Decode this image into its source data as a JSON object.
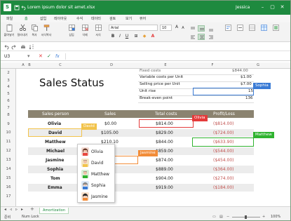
{
  "titlebar": {
    "title": "Lorem ipsum dolor sit amet.xlsx",
    "user": "Jessica",
    "logo": "S"
  },
  "ribbon_tabs": [
    "파일",
    "홈",
    "삽입",
    "레이아웃",
    "수식",
    "데이터",
    "검토",
    "보기",
    "뷰어"
  ],
  "ribbon": {
    "paste_label": "붙여넣기",
    "cut_label": "잘라내기",
    "copy_label": "복사",
    "format_painter_label": "서식복사",
    "insert_label": "삽입",
    "delete_label": "삭제",
    "format_label": "서식",
    "font_name": "Arial",
    "font_size": "10"
  },
  "formula_bar": {
    "name_box": "U3",
    "fx": "fx"
  },
  "columns": [
    "A",
    "B",
    "C",
    "D",
    "E",
    "F",
    "G"
  ],
  "rows": [
    "2",
    "3",
    "4",
    "5",
    "6",
    "7",
    "8",
    "9",
    "10",
    "11",
    "12",
    "13",
    "14",
    "15",
    "16",
    "17"
  ],
  "summary": {
    "fixed_label": "Fixed costs",
    "fixed_value": "$844.00",
    "variable_label": "Variable costs per Unit",
    "variable_value": "$1.00",
    "selling_label": "Selling price per Unit",
    "selling_value": "$7.00",
    "unit_rise_label": "Unit rise",
    "unit_rise_value": "15",
    "breakeven_label": "Break-even point",
    "breakeven_value": "136"
  },
  "sheet_title": "Sales Status",
  "table": {
    "headers": [
      "Sales person",
      "Sales",
      "Total costs",
      "Profit/Loss"
    ],
    "rows": [
      {
        "name": "Olivia",
        "sales": "$0.00",
        "costs": "$814.00",
        "profit": "($814.00)"
      },
      {
        "name": "David",
        "sales": "$105.00",
        "costs": "$829.00",
        "profit": "($724.00)"
      },
      {
        "name": "Matthew",
        "sales": "$210.10",
        "costs": "$844.00",
        "profit": "($633.90)"
      },
      {
        "name": "Michael",
        "sales": "",
        "costs": "$859.00",
        "profit": "($544.00)"
      },
      {
        "name": "Jasmine",
        "sales": "",
        "costs": "$874.00",
        "profit": "($454.00)"
      },
      {
        "name": "Sophia",
        "sales": "",
        "costs": "$889.00",
        "profit": "($364.00)"
      },
      {
        "name": "Tom",
        "sales": "",
        "costs": "$904.00",
        "profit": "($274.00)"
      },
      {
        "name": "Emma",
        "sales": "",
        "costs": "$919.00",
        "profit": "($184.00)"
      }
    ]
  },
  "collaborators": {
    "sophia": "Sophia",
    "olivia": "Olivia",
    "david": "David",
    "matthew": "Matthew",
    "jasmine": "Jasmine"
  },
  "popup_list": [
    "Olivia",
    "David",
    "Matthew",
    "Sophia",
    "Jasmine"
  ],
  "status": {
    "sheet_tab": "Amortization",
    "ready": "준비",
    "num_lock": "Num Lock",
    "zoom": "100%"
  },
  "colors": {
    "brand": "#1e8a3f",
    "table_header": "#8b8370",
    "negative": "#c0504d",
    "olivia": "#e43b3b",
    "sophia": "#3a7bd5",
    "matthew": "#2fb32f",
    "jasmine": "#f28c38",
    "david": "#f2c34b"
  }
}
